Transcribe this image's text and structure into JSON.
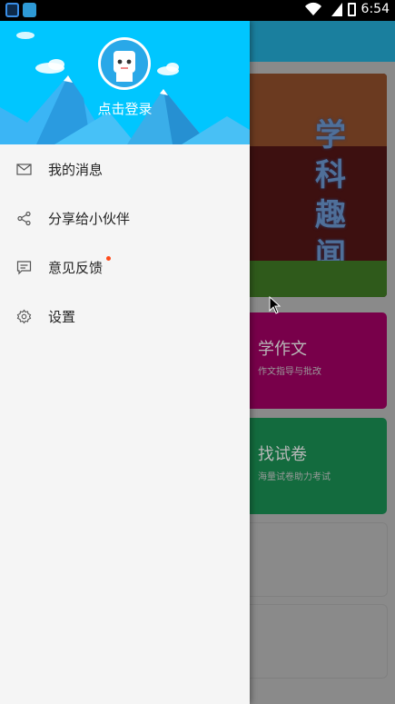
{
  "status_bar": {
    "time": "6:54",
    "icons": [
      "notification-app-icon",
      "notification-app-icon-2",
      "wifi-icon",
      "signal-icon",
      "battery-icon"
    ]
  },
  "background": {
    "banner": {
      "title_chars": [
        "学",
        "科",
        "趣",
        "闻"
      ]
    },
    "cards": [
      {
        "title": "学作文",
        "subtitle": "作文指导与批改",
        "color": "#78004a"
      },
      {
        "title": "找试卷",
        "subtitle": "海量试卷助力考试",
        "color": "#136b3e"
      }
    ]
  },
  "drawer": {
    "header": {
      "login_label": "点击登录",
      "color": "#00c6ff"
    },
    "menu": [
      {
        "label": "我的消息",
        "icon": "mail-icon"
      },
      {
        "label": "分享给小伙伴",
        "icon": "share-icon"
      },
      {
        "label": "意见反馈",
        "icon": "feedback-icon",
        "has_badge": true
      },
      {
        "label": "设置",
        "icon": "settings-icon"
      }
    ]
  },
  "colors": {
    "badge": "#ff4a1a"
  }
}
